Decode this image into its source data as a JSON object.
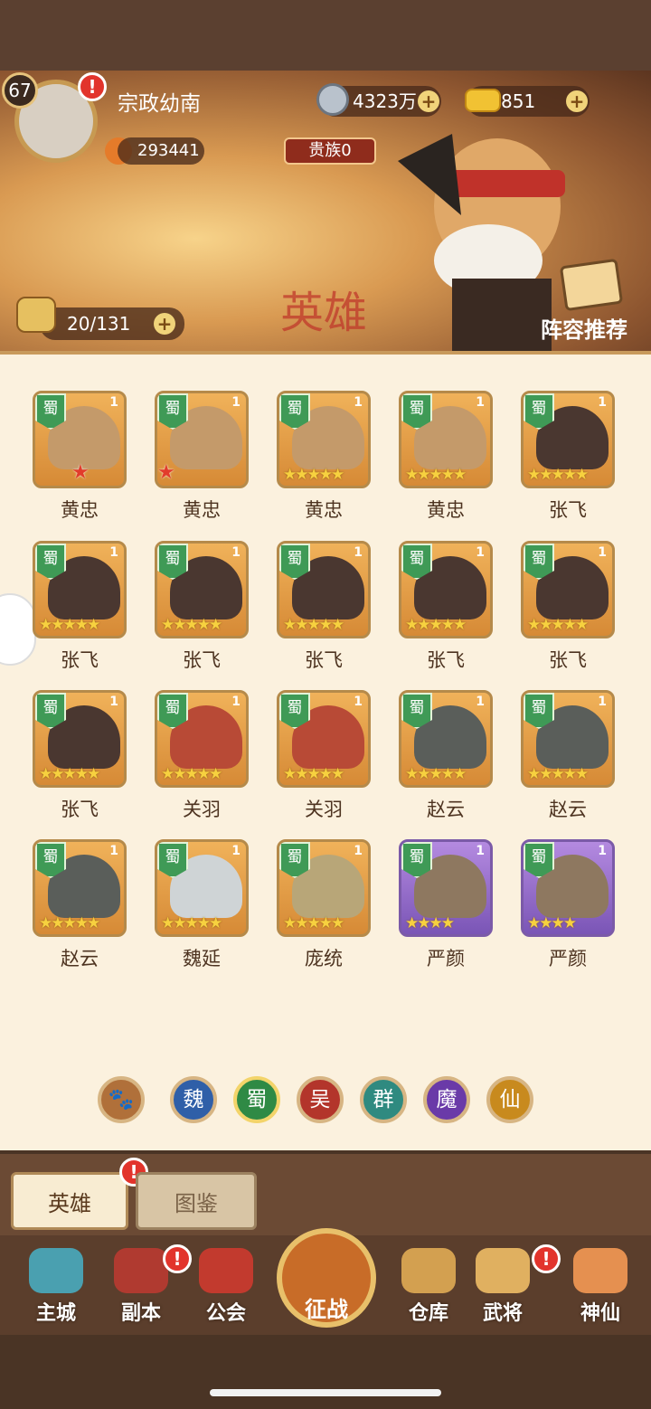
{
  "player": {
    "level": "67",
    "name": "宗政幼南",
    "power": "293441",
    "noble": "贵族0"
  },
  "currency": {
    "coins": "4323万",
    "gold": "851"
  },
  "banner": {
    "hero_count": "20/131",
    "recommend": "阵容推荐",
    "watermark": "英雄"
  },
  "heroes": [
    {
      "name": "黄忠",
      "faction": "蜀",
      "num": "1",
      "stars": "",
      "red_stars": "★",
      "face": "huang",
      "bg": "orange"
    },
    {
      "name": "黄忠",
      "faction": "蜀",
      "num": "1",
      "stars": "",
      "red_stars": "★",
      "face": "huang",
      "bg": "orange"
    },
    {
      "name": "黄忠",
      "faction": "蜀",
      "num": "1",
      "stars": "★★★★★",
      "red_stars": "",
      "face": "huang",
      "bg": "orange"
    },
    {
      "name": "黄忠",
      "faction": "蜀",
      "num": "1",
      "stars": "★★★★★",
      "red_stars": "",
      "face": "huang",
      "bg": "orange"
    },
    {
      "name": "张飞",
      "faction": "蜀",
      "num": "1",
      "stars": "★★★★★",
      "red_stars": "",
      "face": "zhang",
      "bg": "orange"
    },
    {
      "name": "张飞",
      "faction": "蜀",
      "num": "1",
      "stars": "★★★★★",
      "red_stars": "",
      "face": "zhang",
      "bg": "orange"
    },
    {
      "name": "张飞",
      "faction": "蜀",
      "num": "1",
      "stars": "★★★★★",
      "red_stars": "",
      "face": "zhang",
      "bg": "orange"
    },
    {
      "name": "张飞",
      "faction": "蜀",
      "num": "1",
      "stars": "★★★★★",
      "red_stars": "",
      "face": "zhang",
      "bg": "orange"
    },
    {
      "name": "张飞",
      "faction": "蜀",
      "num": "1",
      "stars": "★★★★★",
      "red_stars": "",
      "face": "zhang",
      "bg": "orange"
    },
    {
      "name": "张飞",
      "faction": "蜀",
      "num": "1",
      "stars": "★★★★★",
      "red_stars": "",
      "face": "zhang",
      "bg": "orange"
    },
    {
      "name": "张飞",
      "faction": "蜀",
      "num": "1",
      "stars": "★★★★★",
      "red_stars": "",
      "face": "zhang",
      "bg": "orange"
    },
    {
      "name": "关羽",
      "faction": "蜀",
      "num": "1",
      "stars": "★★★★★",
      "red_stars": "",
      "face": "guan",
      "bg": "orange"
    },
    {
      "name": "关羽",
      "faction": "蜀",
      "num": "1",
      "stars": "★★★★★",
      "red_stars": "",
      "face": "guan",
      "bg": "orange"
    },
    {
      "name": "赵云",
      "faction": "蜀",
      "num": "1",
      "stars": "★★★★★",
      "red_stars": "",
      "face": "zhao",
      "bg": "orange"
    },
    {
      "name": "赵云",
      "faction": "蜀",
      "num": "1",
      "stars": "★★★★★",
      "red_stars": "",
      "face": "zhao",
      "bg": "orange"
    },
    {
      "name": "赵云",
      "faction": "蜀",
      "num": "1",
      "stars": "★★★★★",
      "red_stars": "",
      "face": "zhao",
      "bg": "orange"
    },
    {
      "name": "魏延",
      "faction": "蜀",
      "num": "1",
      "stars": "★★★★★",
      "red_stars": "",
      "face": "wei",
      "bg": "orange"
    },
    {
      "name": "庞统",
      "faction": "蜀",
      "num": "1",
      "stars": "★★★★★",
      "red_stars": "",
      "face": "pang",
      "bg": "orange"
    },
    {
      "name": "严颜",
      "faction": "蜀",
      "num": "1",
      "stars": "★★★★",
      "red_stars": "",
      "face": "yan",
      "bg": "purple"
    },
    {
      "name": "严颜",
      "faction": "蜀",
      "num": "1",
      "stars": "★★★★",
      "red_stars": "",
      "face": "yan",
      "bg": "purple"
    }
  ],
  "filters": [
    {
      "label": "",
      "icon": "paw-icon",
      "color": "#b0703a"
    },
    {
      "label": "魏",
      "icon": "",
      "color": "#2f5fa8"
    },
    {
      "label": "蜀",
      "icon": "",
      "color": "#2f8a45"
    },
    {
      "label": "吴",
      "icon": "",
      "color": "#b3352b"
    },
    {
      "label": "群",
      "icon": "",
      "color": "#2f8a80"
    },
    {
      "label": "魔",
      "icon": "",
      "color": "#6a3aa8"
    },
    {
      "label": "仙",
      "icon": "",
      "color": "#c88a1e"
    }
  ],
  "tabs": {
    "heroes": "英雄",
    "codex": "图鉴"
  },
  "nav": [
    {
      "label": "主城",
      "color": "#4aa0b0"
    },
    {
      "label": "副本",
      "color": "#b03a30"
    },
    {
      "label": "公会",
      "color": "#c23a2e"
    },
    {
      "label": "征战",
      "color": ""
    },
    {
      "label": "仓库",
      "color": "#d3a050"
    },
    {
      "label": "武将",
      "color": "#e0b060"
    },
    {
      "label": "神仙",
      "color": "#e59050"
    }
  ]
}
